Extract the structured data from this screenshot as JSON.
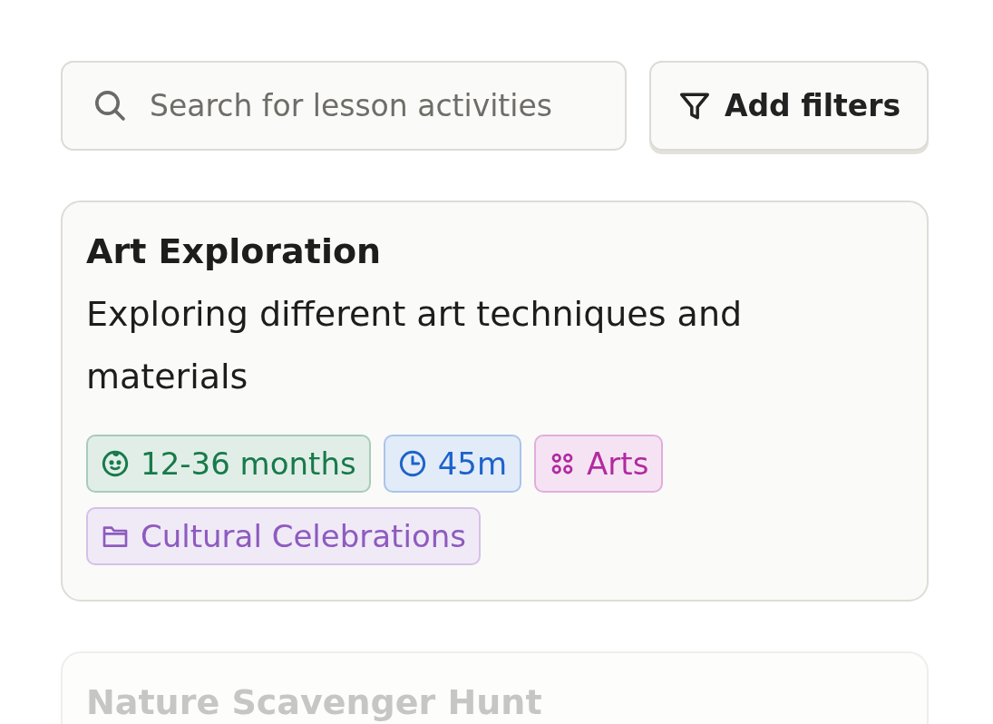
{
  "search": {
    "placeholder": "Search for lesson activities"
  },
  "filter_button": {
    "label": "Add filters"
  },
  "cards": [
    {
      "title": "Art Exploration",
      "description": "Exploring different art techniques and materials",
      "faded": false,
      "tags": [
        {
          "kind": "age",
          "label": "12-36 months",
          "color": "#177a4a"
        },
        {
          "kind": "duration",
          "label": "45m",
          "color": "#1d63c9"
        },
        {
          "kind": "category",
          "label": "Arts",
          "color": "#b02ba0"
        },
        {
          "kind": "theme",
          "label": "Cultural Celebrations",
          "color": "#8e5bbf"
        }
      ]
    },
    {
      "title": "Nature Scavenger Hunt",
      "faded": true
    }
  ]
}
